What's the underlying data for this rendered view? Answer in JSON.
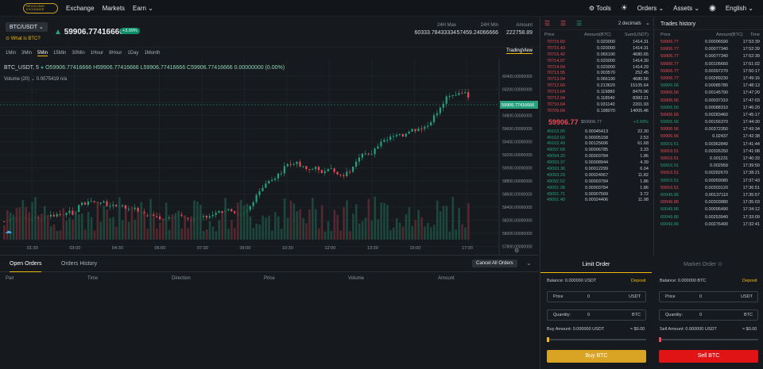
{
  "nav": {
    "logo": "REVOLVING EXCHANGE",
    "exchange": "Exchange",
    "markets": "Markets",
    "earn": "Earn ⌄",
    "tools": "Tools",
    "orders": "Orders ⌄",
    "assets": "Assets ⌄",
    "lang": "English ⌄"
  },
  "symbol": {
    "pair": "BTC/USDT ⌄",
    "whatis": "What is BTC?",
    "price": "59906.77416666",
    "change": "+3.99%",
    "high_label": "24H Max",
    "high": "60333.78433334",
    "low_label": "24H Min",
    "low": "57459.24066666",
    "amount_label": "Amount",
    "amount": "222758.89"
  },
  "timeframes": [
    "1Min",
    "3Min",
    "5Min",
    "15Min",
    "30Min",
    "1Hour",
    "8Hour",
    "1Day",
    "1Month"
  ],
  "active_tf": "5Min",
  "tradingview": "TradingView",
  "ohlc": {
    "label": "BTC_USDT, 5",
    "o": "O59906.77416666",
    "h": "H59906.77416666",
    "l": "L59906.77416666",
    "c": "C59906.77416666",
    "d": "0.00000000 (0.00%)"
  },
  "vol": "Volume (20) ⌄ 0.0075419  n/a",
  "price_axis": [
    "60400.00000000",
    "60200.00000000",
    "60000.00000000",
    "59800.00000000",
    "59600.00000000",
    "59400.00000000",
    "59200.00000000",
    "59000.00000000",
    "58800.00000000",
    "58600.00000000",
    "58400.00000000",
    "58200.00000000",
    "58000.00000000",
    "57800.00000000"
  ],
  "price_tag": "59906.77416666",
  "time_axis": [
    "01:30",
    "03:00",
    "04:30",
    "06:00",
    "07:30",
    "09:00",
    "10:30",
    "12:00",
    "13:30",
    "15:00",
    "17:00"
  ],
  "orders_tabs": {
    "open": "Open Orders",
    "history": "Orders History",
    "cancel": "Cancel All Orders"
  },
  "orders_cols": [
    "Pair",
    "Time",
    "Direction",
    "Price",
    "Volume",
    "Amount"
  ],
  "orderbook": {
    "decimals": "2 decimals",
    "cols": [
      "Price",
      "Amount(BTC)",
      "Sum(USDT)"
    ],
    "asks": [
      [
        "70715.60",
        "0.020000",
        "1414.31"
      ],
      [
        "70715.43",
        "0.020000",
        "1414.31"
      ],
      [
        "70715.42",
        "0.066190",
        "4680.65"
      ],
      [
        "70714.97",
        "0.020000",
        "1414.30"
      ],
      [
        "70714.54",
        "0.020000",
        "1414.29"
      ],
      [
        "70713.95",
        "0.003570",
        "252.45"
      ],
      [
        "70713.94",
        "0.066190",
        "4680.56"
      ],
      [
        "70712.69",
        "0.213620",
        "15105.64"
      ],
      [
        "70712.64",
        "0.119880",
        "8476.96"
      ],
      [
        "70712.04",
        "0.118540",
        "8382.21"
      ],
      [
        "70710.64",
        "0.031140",
        "2201.93"
      ],
      [
        "70709.64",
        "0.198070",
        "14005.46"
      ]
    ],
    "mid_price": "59906.77",
    "mid_sub": "$59906.77",
    "mid_chg": "+3.99%",
    "bids": [
      [
        "49103.90",
        "0.00045413",
        "22.30"
      ],
      [
        "49102.60",
        "0.00005158",
        "2.53"
      ],
      [
        "49102.49",
        "0.00125606",
        "61.68"
      ],
      [
        "49097.68",
        "0.00006785",
        "3.33"
      ],
      [
        "49094.20",
        "0.00003784",
        "1.86"
      ],
      [
        "49093.37",
        "0.00008944",
        "4.39"
      ],
      [
        "49093.36",
        "0.00012299",
        "6.04"
      ],
      [
        "49093.29",
        "0.00024067",
        "11.82"
      ],
      [
        "49092.52",
        "0.00003784",
        "1.86"
      ],
      [
        "49091.98",
        "0.00003784",
        "1.86"
      ],
      [
        "49091.71",
        "0.00007569",
        "3.72"
      ],
      [
        "49091.40",
        "0.00024406",
        "11.98"
      ]
    ]
  },
  "trades": {
    "title": "Trades history",
    "cols": [
      "Price",
      "Amount(BTC)",
      "Time"
    ],
    "rows": [
      [
        "59906.77",
        "0.00096590",
        "17:53:39",
        "r"
      ],
      [
        "59906.77",
        "0.00077340",
        "17:52:39",
        "r"
      ],
      [
        "59906.77",
        "0.00077340",
        "17:52:39",
        "r"
      ],
      [
        "59906.77",
        "0.00105660",
        "17:51:02",
        "r"
      ],
      [
        "59906.77",
        "0.00397270",
        "17:50:17",
        "r"
      ],
      [
        "59906.77",
        "0.00289230",
        "17:49:16",
        "r"
      ],
      [
        "59906.56",
        "0.00085780",
        "17:48:13",
        "g"
      ],
      [
        "59906.56",
        "0.00145790",
        "17:47:20",
        "r"
      ],
      [
        "59906.56",
        "0.00037310",
        "17:47:03",
        "r"
      ],
      [
        "59906.56",
        "0.00088310",
        "17:46:20",
        "g"
      ],
      [
        "59906.56",
        "0.00283460",
        "17:45:17",
        "r"
      ],
      [
        "59906.56",
        "0.00156370",
        "17:44:30",
        "g"
      ],
      [
        "59906.56",
        "0.00372350",
        "17:43:34",
        "r"
      ],
      [
        "59906.56",
        "0.02437",
        "17:42:38",
        "r"
      ],
      [
        "59916.51",
        "0.00362840",
        "17:41:44",
        "g"
      ],
      [
        "59916.51",
        "0.00326250",
        "17:41:08",
        "r"
      ],
      [
        "59916.51",
        "0.001231",
        "17:40:33",
        "r"
      ],
      [
        "59916.51",
        "0.002959",
        "17:39:50",
        "g"
      ],
      [
        "59916.51",
        "0.00282670",
        "17:38:21",
        "r"
      ],
      [
        "59916.51",
        "0.00059080",
        "17:37:43",
        "g"
      ],
      [
        "59916.51",
        "0.00303120",
        "17:36:51",
        "r"
      ],
      [
        "60049.86",
        "0.00137110",
        "17:35:57",
        "g"
      ],
      [
        "60049.86",
        "0.00303880",
        "17:35:03",
        "r"
      ],
      [
        "60049.86",
        "0.00096490",
        "17:34:12",
        "g"
      ],
      [
        "60049.86",
        "0.00253940",
        "17:33:09",
        "g"
      ],
      [
        "60049.86",
        "0.00276490",
        "17:32:41",
        "g"
      ]
    ]
  },
  "form": {
    "limit": "Limit Order",
    "market": "Market Order ⊙",
    "balance_l": "Balance: 0.000000 USDT",
    "balance_r": "Balance: 0.000000 BTC",
    "deposit": "Deposit",
    "price": "Price",
    "zero": "0",
    "usdt": "USDT",
    "btc": "BTC",
    "qty": "Quantity:",
    "buy_amt": "Buy Amount: 0.000000 USDT",
    "sell_amt": "Sell Amount: 0.000000 USDT",
    "approx": "≈ $0.00",
    "buy": "Buy BTC",
    "sell": "Sell BTC"
  },
  "colors": {
    "up": "#26a17b",
    "down": "#e84b57",
    "accent": "#f0b90b"
  }
}
